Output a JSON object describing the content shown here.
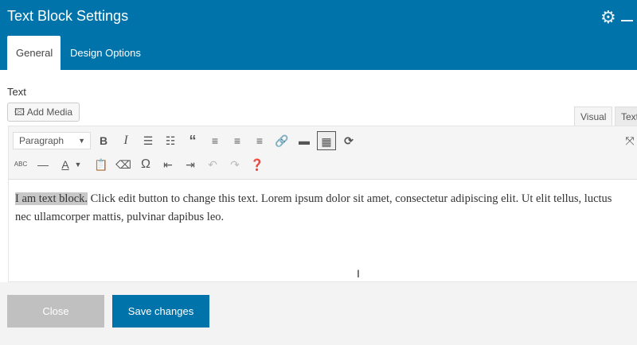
{
  "header": {
    "title": "Text Block Settings",
    "icons": [
      "gear-icon",
      "minimize-icon"
    ],
    "color": "#0073aa"
  },
  "tabs": [
    {
      "label": "General",
      "active": true
    },
    {
      "label": "Design Options",
      "active": false
    }
  ],
  "field_label": "Text",
  "add_media": "Add Media",
  "editor_tabs": [
    "Visual",
    "Text"
  ],
  "format_select": "Paragraph",
  "content": {
    "highlighted": "I am text block.",
    "rest": " Click edit button to change this text. Lorem ipsum dolor sit amet, consectetur adipiscing elit. Ut elit tellus, luctus nec ullamcorper mattis, pulvinar dapibus leo."
  },
  "footer": {
    "close": "Close",
    "save": "Save changes"
  }
}
